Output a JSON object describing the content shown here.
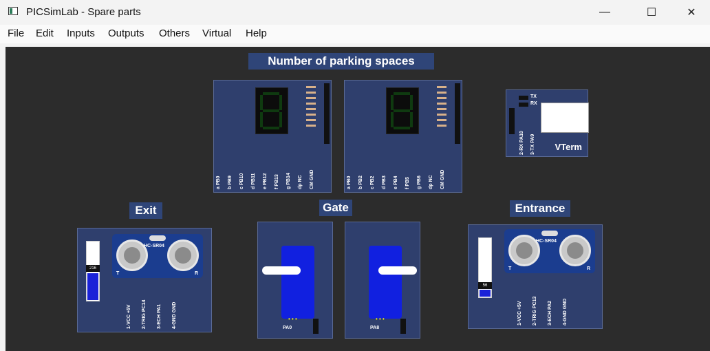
{
  "window": {
    "title": "PICSimLab - Spare parts",
    "minimize": "—",
    "maximize": "☐",
    "close": "✕"
  },
  "menu": [
    "File",
    "Edit",
    "Inputs",
    "Outputs",
    "Others",
    "Virtual",
    "Help"
  ],
  "labels": {
    "parking": "Number of parking spaces",
    "exit": "Exit",
    "gate": "Gate",
    "entrance": "Entrance"
  },
  "display1": {
    "pins": [
      "a PB0",
      "b PB9",
      "c PB10",
      "d PB11",
      "e PB12",
      "f PB13",
      "g PB14",
      "dp NC",
      "CM GND"
    ]
  },
  "display2": {
    "pins": [
      "a PB0",
      "b PB2",
      "c PB2",
      "d PB3",
      "e PB4",
      "f PB5",
      "g PB6",
      "dp NC",
      "CM GND"
    ]
  },
  "vterm": {
    "tx": "TX",
    "rx": "RX",
    "name": "VTerm",
    "pins": [
      "2-RX PA10",
      "3-TX PA9"
    ]
  },
  "exit_sensor": {
    "model": "HC-SR04",
    "value": "216",
    "level": 0.45,
    "t": "T",
    "r": "R",
    "pins": [
      "1-VCC +5V",
      "2-TRIG PC14",
      "3-ECH PA1",
      "4-GND GND"
    ]
  },
  "entrance_sensor": {
    "model": "HC-SR04",
    "value": "56",
    "level": 0.12,
    "t": "T",
    "r": "R",
    "pins": [
      "1-VCC +5V",
      "2-TRIG PC13",
      "3-ECH PA2",
      "4-GND GND"
    ]
  },
  "servo1": {
    "pin": "PA0"
  },
  "servo2": {
    "pin": "PA8"
  }
}
